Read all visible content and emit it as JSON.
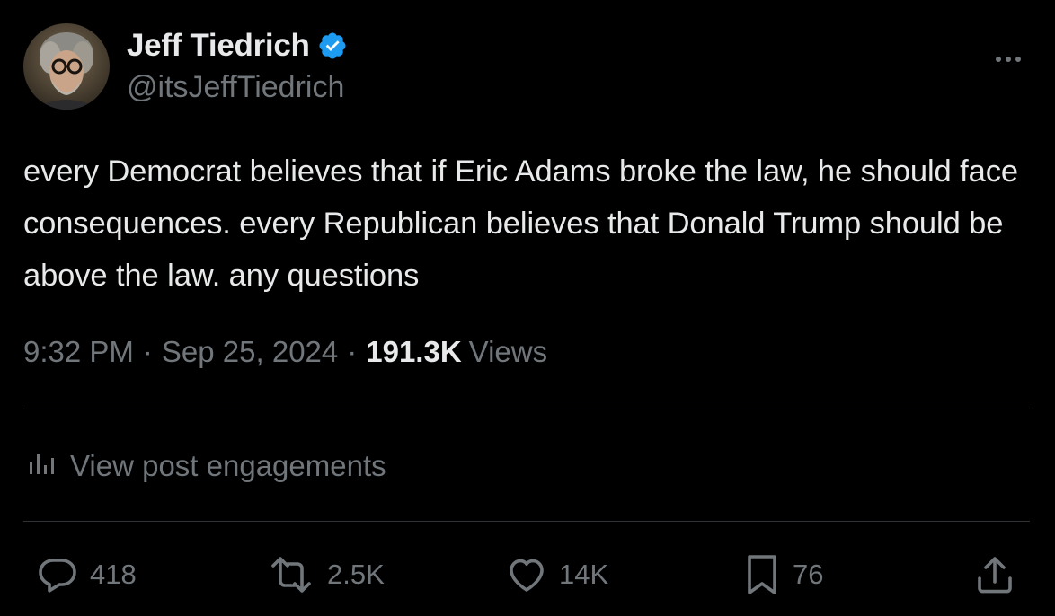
{
  "author": {
    "display_name": "Jeff Tiedrich",
    "handle": "@itsJeffTiedrich",
    "verified": true
  },
  "post": {
    "text": "every Democrat believes that if Eric Adams broke the law, he should face consequences. every Republican believes that Donald Trump should be above the law. any questions",
    "time": "9:32 PM",
    "date": "Sep 25, 2024",
    "separator": "·",
    "views_count": "191.3K",
    "views_label": "Views"
  },
  "engagements": {
    "label": "View post engagements",
    "icon": "analytics-bars-icon"
  },
  "actions": {
    "replies": {
      "icon": "reply-icon",
      "count": "418"
    },
    "reposts": {
      "icon": "repost-icon",
      "count": "2.5K"
    },
    "likes": {
      "icon": "heart-icon",
      "count": "14K"
    },
    "bookmarks": {
      "icon": "bookmark-icon",
      "count": "76"
    },
    "share": {
      "icon": "share-icon"
    }
  },
  "colors": {
    "background": "#000000",
    "primary_text": "#e7e9ea",
    "secondary_text": "#71767b",
    "divider": "#2f3336",
    "verified_badge": "#1d9bf0"
  }
}
